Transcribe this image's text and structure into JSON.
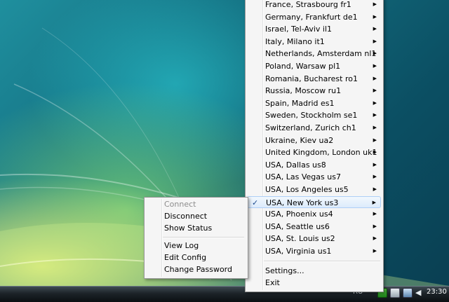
{
  "server_menu": {
    "items": [
      {
        "label": "France, Strasbourg fr1"
      },
      {
        "label": "Germany, Frankfurt de1"
      },
      {
        "label": "Israel, Tel-Aviv il1"
      },
      {
        "label": "Italy, Milano it1"
      },
      {
        "label": "Netherlands, Amsterdam nl1"
      },
      {
        "label": "Poland, Warsaw pl1"
      },
      {
        "label": "Romania, Bucharest ro1"
      },
      {
        "label": "Russia, Moscow ru1"
      },
      {
        "label": "Spain, Madrid es1"
      },
      {
        "label": "Sweden, Stockholm se1"
      },
      {
        "label": "Switzerland, Zurich ch1"
      },
      {
        "label": "Ukraine, Kiev ua2"
      },
      {
        "label": "United Kingdom, London uk1"
      },
      {
        "label": "USA, Dallas us8"
      },
      {
        "label": "USA, Las Vegas us7"
      },
      {
        "label": "USA, Los Angeles us5"
      },
      {
        "label": "USA, New York us3",
        "checked": true,
        "highlighted": true
      },
      {
        "label": "USA, Phoenix us4"
      },
      {
        "label": "USA, Seattle us6"
      },
      {
        "label": "USA, St. Louis us2"
      },
      {
        "label": "USA, Virginia us1"
      }
    ],
    "submenu_arrow": "▶",
    "check_mark": "✓",
    "settings": "Settings...",
    "exit": "Exit"
  },
  "context_menu": {
    "connect": "Connect",
    "disconnect": "Disconnect",
    "show_status": "Show Status",
    "view_log": "View Log",
    "edit_config": "Edit Config",
    "change_password": "Change Password"
  },
  "taskbar": {
    "language": "RU",
    "clock": "23:30",
    "tray_icons": [
      "vpn-tray-icon",
      "network-icon",
      "display-icon",
      "volume-icon"
    ]
  },
  "colors": {
    "menu_bg": "#f5f5f5",
    "highlight_border": "#aecff7",
    "disabled_text": "#8d8d8d"
  }
}
